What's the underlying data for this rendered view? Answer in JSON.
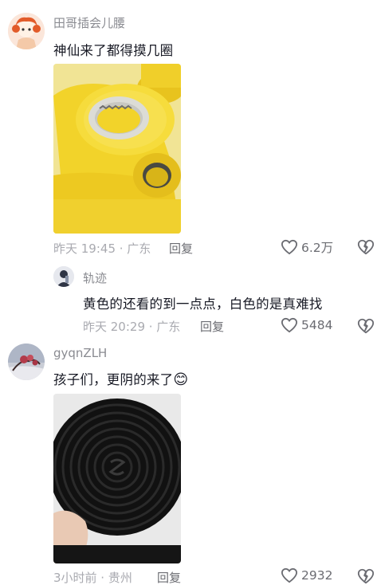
{
  "comments": [
    {
      "username": "田哥插会儿腰",
      "text": "神仙来了都得摸几圈",
      "meta": "昨天 19:45 · 广东",
      "reply_label": "回复",
      "likes": "6.2万",
      "image_alt": "yellow-tape-rolls"
    },
    {
      "username": "轨迹",
      "text": "黄色的还看的到一点点，白色的是真难找",
      "meta": "昨天 20:29 · 广东",
      "reply_label": "回复",
      "likes": "5484"
    },
    {
      "username": "gyqnZLH",
      "text": "孩子们，更阴的来了",
      "emoji": "😊",
      "meta": "3小时前 · 贵州",
      "reply_label": "回复",
      "likes": "2932",
      "image_alt": "black-tape-roll"
    }
  ],
  "icons": {
    "like": "heart-outline-icon",
    "dislike": "broken-heart-icon"
  },
  "colors": {
    "text": "#161823",
    "muted": "#a9aab0",
    "tape_yellow": "#f2d32a"
  }
}
